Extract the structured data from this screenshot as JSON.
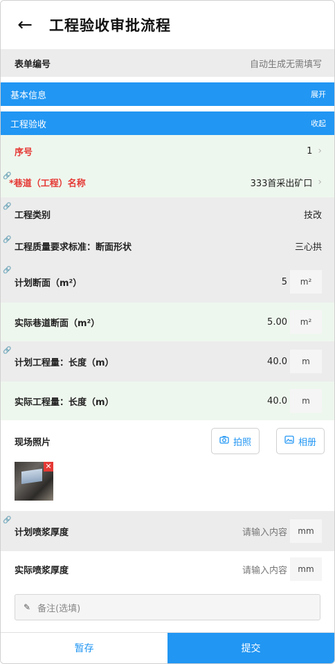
{
  "header": {
    "title": "工程验收审批流程",
    "back_icon": "arrow-left-icon"
  },
  "form_no": {
    "label": "表单编号",
    "value": "自动生成无需填写"
  },
  "sections": {
    "basic": {
      "label": "基本信息",
      "action": "展开"
    },
    "acceptance": {
      "label": "工程验收",
      "action": "收起"
    }
  },
  "fields": {
    "seq": {
      "label": "序号",
      "value": "1"
    },
    "tunnel": {
      "label": "*巷道（工程）名称",
      "value": "333首采出矿口"
    },
    "category": {
      "label": "工程类别",
      "value": "技改"
    },
    "standard": {
      "label": "工程质量要求标准：断面形状",
      "value": "三心拱"
    },
    "plan_section": {
      "label": "计划断面（m²）",
      "value": "5",
      "unit": "m²"
    },
    "actual_section": {
      "label": "实际巷道断面（m²）",
      "value": "5.00",
      "unit": "m²"
    },
    "plan_length": {
      "label": "计划工程量：长度（m）",
      "value": "40.0",
      "unit": "m"
    },
    "actual_length": {
      "label": "实际工程量：长度（m）",
      "value": "40.0",
      "unit": "m"
    },
    "photos": {
      "label": "现场照片",
      "camera": "拍照",
      "album": "相册"
    },
    "plan_spray": {
      "label": "计划喷浆厚度",
      "placeholder": "请输入内容",
      "unit": "mm"
    },
    "actual_spray": {
      "label": "实际喷浆厚度",
      "placeholder": "请输入内容",
      "unit": "mm"
    }
  },
  "remark": {
    "placeholder": "备注(选填)"
  },
  "footer": {
    "save": "暂存",
    "submit": "提交"
  },
  "colors": {
    "accent": "#2196f3",
    "required": "#e53935"
  }
}
